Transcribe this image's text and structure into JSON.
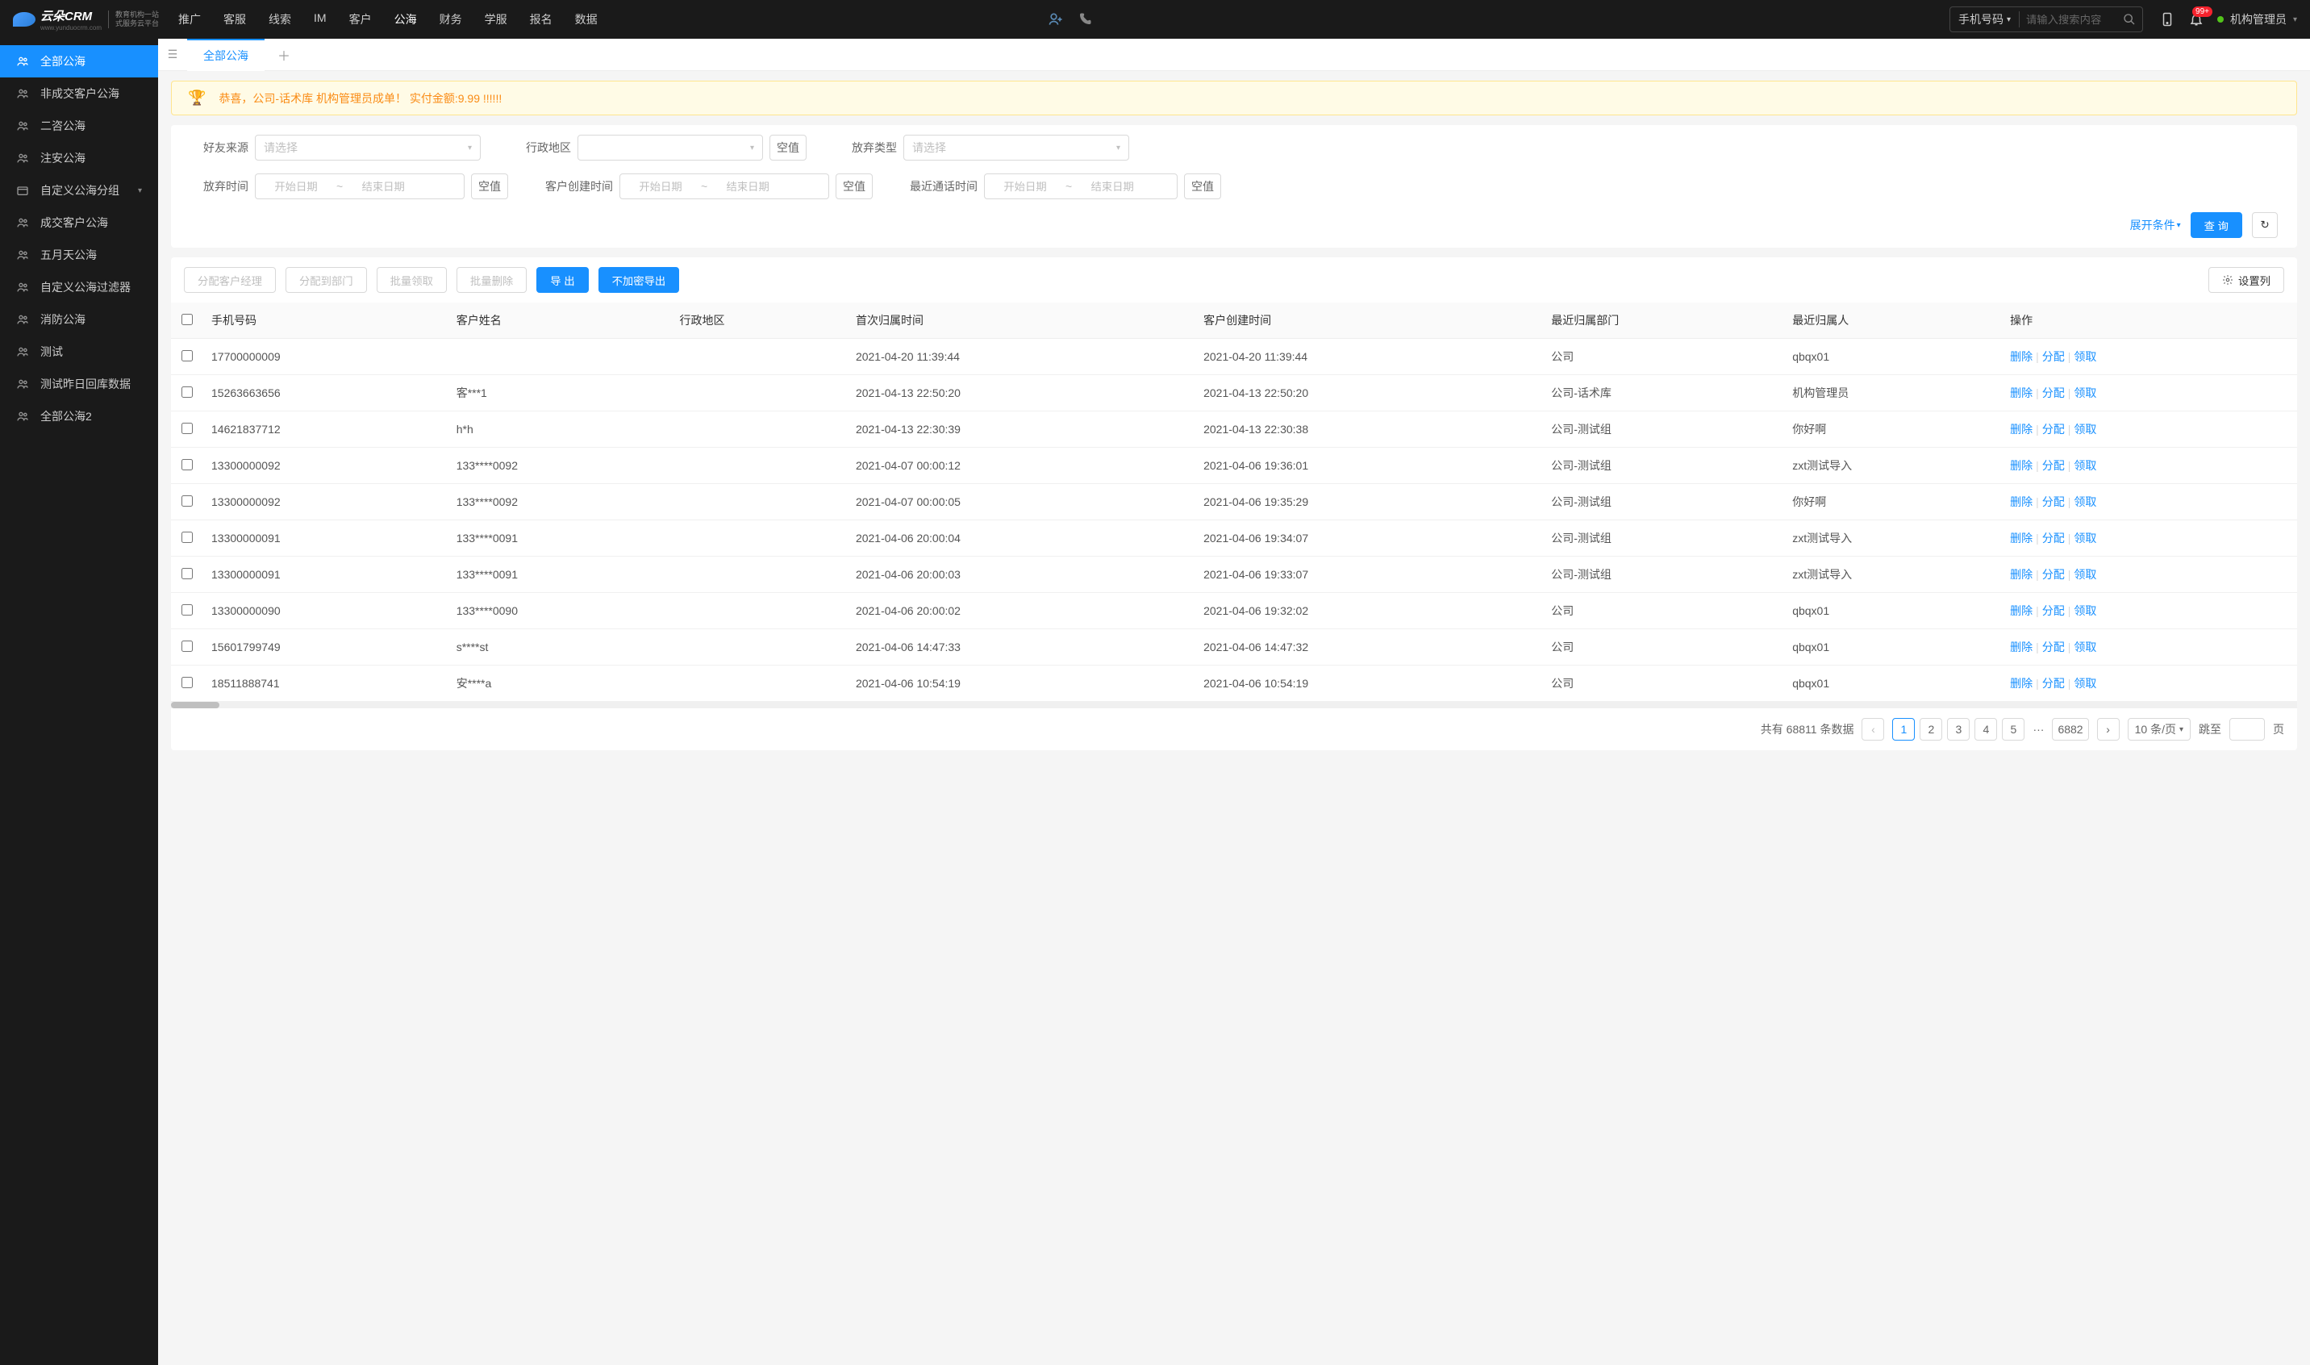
{
  "brand": {
    "name": "云朵CRM",
    "domain": "www.yunduocrm.com",
    "tag1": "教育机构一站",
    "tag2": "式服务云平台"
  },
  "nav": [
    "推广",
    "客服",
    "线索",
    "IM",
    "客户",
    "公海",
    "财务",
    "学服",
    "报名",
    "数据"
  ],
  "nav_active": 5,
  "search": {
    "type": "手机号码",
    "placeholder": "请输入搜索内容"
  },
  "notif_count": "99+",
  "user": "机构管理员",
  "sidebar": [
    {
      "label": "全部公海",
      "icon": "users"
    },
    {
      "label": "非成交客户公海",
      "icon": "users"
    },
    {
      "label": "二咨公海",
      "icon": "users"
    },
    {
      "label": "注安公海",
      "icon": "users"
    },
    {
      "label": "自定义公海分组",
      "icon": "folder",
      "expand": true
    },
    {
      "label": "成交客户公海",
      "icon": "users"
    },
    {
      "label": "五月天公海",
      "icon": "users"
    },
    {
      "label": "自定义公海过滤器",
      "icon": "users"
    },
    {
      "label": "消防公海",
      "icon": "users"
    },
    {
      "label": "测试",
      "icon": "users"
    },
    {
      "label": "测试昨日回库数据",
      "icon": "users"
    },
    {
      "label": "全部公海2",
      "icon": "users"
    }
  ],
  "sidebar_active": 0,
  "tab_label": "全部公海",
  "banner": "恭喜，公司-话术库  机构管理员成单！  实付金额:9.99 !!!!!!",
  "filters": {
    "source": "好友来源",
    "source_ph": "请选择",
    "region": "行政地区",
    "empty": "空值",
    "abandon_type": "放弃类型",
    "abandon_type_ph": "请选择",
    "abandon_time": "放弃时间",
    "create_time": "客户创建时间",
    "call_time": "最近通话时间",
    "start_ph": "开始日期",
    "end_ph": "结束日期",
    "expand": "展开条件",
    "query": "查 询"
  },
  "toolbar": {
    "assign_mgr": "分配客户经理",
    "assign_dept": "分配到部门",
    "batch_get": "批量领取",
    "batch_del": "批量删除",
    "export": "导 出",
    "export_plain": "不加密导出",
    "config": "设置列"
  },
  "columns": [
    "手机号码",
    "客户姓名",
    "行政地区",
    "首次归属时间",
    "客户创建时间",
    "最近归属部门",
    "最近归属人",
    "操作"
  ],
  "ops": {
    "del": "删除",
    "assign": "分配",
    "get": "领取"
  },
  "rows": [
    {
      "phone": "17700000009",
      "name": "",
      "region": "",
      "first": "2021-04-20 11:39:44",
      "create": "2021-04-20 11:39:44",
      "dept": "公司",
      "owner": "qbqx01"
    },
    {
      "phone": "15263663656",
      "name": "客***1",
      "region": "",
      "first": "2021-04-13 22:50:20",
      "create": "2021-04-13 22:50:20",
      "dept": "公司-话术库",
      "owner": "机构管理员"
    },
    {
      "phone": "14621837712",
      "name": "h*h",
      "region": "",
      "first": "2021-04-13 22:30:39",
      "create": "2021-04-13 22:30:38",
      "dept": "公司-测试组",
      "owner": "你好啊"
    },
    {
      "phone": "13300000092",
      "name": "133****0092",
      "region": "",
      "first": "2021-04-07 00:00:12",
      "create": "2021-04-06 19:36:01",
      "dept": "公司-测试组",
      "owner": "zxt测试导入"
    },
    {
      "phone": "13300000092",
      "name": "133****0092",
      "region": "",
      "first": "2021-04-07 00:00:05",
      "create": "2021-04-06 19:35:29",
      "dept": "公司-测试组",
      "owner": "你好啊"
    },
    {
      "phone": "13300000091",
      "name": "133****0091",
      "region": "",
      "first": "2021-04-06 20:00:04",
      "create": "2021-04-06 19:34:07",
      "dept": "公司-测试组",
      "owner": "zxt测试导入"
    },
    {
      "phone": "13300000091",
      "name": "133****0091",
      "region": "",
      "first": "2021-04-06 20:00:03",
      "create": "2021-04-06 19:33:07",
      "dept": "公司-测试组",
      "owner": "zxt测试导入"
    },
    {
      "phone": "13300000090",
      "name": "133****0090",
      "region": "",
      "first": "2021-04-06 20:00:02",
      "create": "2021-04-06 19:32:02",
      "dept": "公司",
      "owner": "qbqx01"
    },
    {
      "phone": "15601799749",
      "name": "s****st",
      "region": "",
      "first": "2021-04-06 14:47:33",
      "create": "2021-04-06 14:47:32",
      "dept": "公司",
      "owner": "qbqx01"
    },
    {
      "phone": "18511888741",
      "name": "安****a",
      "region": "",
      "first": "2021-04-06 10:54:19",
      "create": "2021-04-06 10:54:19",
      "dept": "公司",
      "owner": "qbqx01"
    }
  ],
  "pager": {
    "total_pre": "共有",
    "total": "68811",
    "total_suf": "条数据",
    "pages": [
      "1",
      "2",
      "3",
      "4",
      "5"
    ],
    "ellipsis": "···",
    "last": "6882",
    "size": "10 条/页",
    "jump_pre": "跳至",
    "jump_suf": "页"
  }
}
